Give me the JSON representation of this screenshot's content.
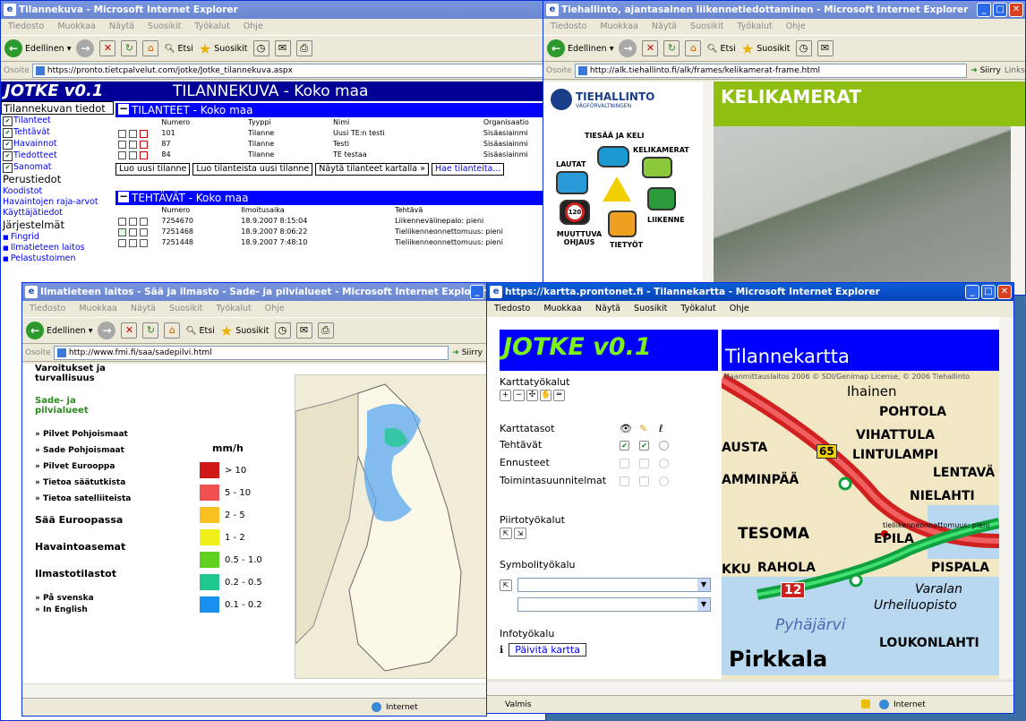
{
  "menu": [
    "Tiedosto",
    "Muokkaa",
    "Näytä",
    "Suosikit",
    "Työkalut",
    "Ohje"
  ],
  "toolbar": {
    "back": "Edellinen",
    "search": "Etsi",
    "favorites": "Suosikit"
  },
  "address_label": "Osoite",
  "go_label": "Siirry",
  "links_label": "Links",
  "status_internet": "Internet",
  "jotke": {
    "title": "Tilannekuva - Microsoft Internet Explorer",
    "url": "https://pronto.tietcpalvelut.com/jotke/Jotke_tilannekuva.aspx",
    "logo": "JOTKE v0.1",
    "page_title": "TILANNEKUVA - Koko maa",
    "side_header1": "Tilannekuvan tiedot",
    "side_checks": [
      "Tilanteet",
      "Tehtävät",
      "Havainnot",
      "Tiedotteet",
      "Sanomat"
    ],
    "side_header2": "Perustiedot",
    "side_links1": [
      "Koodistot",
      "Havaintojen raja-arvot",
      "Käyttäjätiedot"
    ],
    "side_header3": "Järjestelmät",
    "side_links2": [
      "Fingrid",
      "Ilmatieteen laitos",
      "Pelastustoimen"
    ],
    "tilanteet_header": "TILANTEET - Koko maa",
    "tilanteet_cols": [
      "Numero",
      "Tyyppi",
      "Nimi",
      "Organisaatio"
    ],
    "tilanteet_rows": [
      [
        "101",
        "Tilanne",
        "Uusi TE:n testi",
        "Sisäasiainmi"
      ],
      [
        "87",
        "Tilanne",
        "Testi",
        "Sisäasiainmi"
      ],
      [
        "84",
        "Tilanne",
        "TE testaa",
        "Sisäasiainmi"
      ]
    ],
    "buttons": [
      "Luo uusi tilanne",
      "Luo tilanteista uusi tilanne",
      "Näytä tilanteet kartalla »",
      "Hae tilanteita..."
    ],
    "tehtavat_header": "TEHTÄVÄT - Koko maa",
    "tehtavat_cols": [
      "Numero",
      "Ilmoitusaika",
      "Tehtävä"
    ],
    "tehtavat_rows": [
      [
        "7254670",
        "18.9.2007 8:15:04",
        "Liikennevälinepalo: pieni"
      ],
      [
        "7251468",
        "18.9.2007 8:06:22",
        "Tieliikenneonnettomuus: pieni"
      ],
      [
        "7251448",
        "18.9.2007 7:48:10",
        "Tieliikenneonnettomuus: pieni"
      ]
    ]
  },
  "tiehallinto": {
    "title": "Tiehallinto, ajantasainen liikennetiedottaminen - Microsoft Internet Explorer",
    "url": "http://alk.tiehallinto.fi/alk/frames/kelikamerat-frame.html",
    "org": "TIEHALLINTO",
    "org_sub": "VÄGFÖRVALTNINGEN",
    "banner": "KELIKAMERAT",
    "icons": [
      "TIESÄÄ JA KELI",
      "KELIKAMERAT",
      "LAUTAT",
      "LIIKENNE",
      "MUUTTUVA OHJAUS",
      "TIETYÖT"
    ],
    "speed": "120"
  },
  "fmi": {
    "title": "Ilmatieteen laitos - Sää ja ilmasto - Sade- ja pilvialueet - Microsoft Internet Explorer",
    "url": "http://www.fmi.fi/saa/sadepilvi.html",
    "cat1": "Varoitukset ja turvallisuus",
    "cat2": "Sade- ja pilvialueet",
    "items": [
      "» Pilvet Pohjoismaat",
      "» Sade Pohjoismaat",
      "» Pilvet Eurooppa",
      "» Tietoa säätutkista",
      "» Tietoa satelliiteista"
    ],
    "sections": [
      "Sää Euroopassa",
      "Havaintoasemat",
      "Ilmastotilastot"
    ],
    "langs": [
      "» På svenska",
      "» In English"
    ],
    "unit": "mm/h",
    "legend": [
      {
        "label": "> 10",
        "color": "#d01818"
      },
      {
        "label": "5 - 10",
        "color": "#f05050"
      },
      {
        "label": "2 - 5",
        "color": "#f8c020"
      },
      {
        "label": "1 - 2",
        "color": "#f0f018"
      },
      {
        "label": "0.5 - 1.0",
        "color": "#60d020"
      },
      {
        "label": "0.2 - 0.5",
        "color": "#20c890"
      },
      {
        "label": "0.1 - 0.2",
        "color": "#1890f0"
      }
    ]
  },
  "kartta": {
    "title": "https://kartta.prontonet.fi - Tilannekartta - Microsoft Internet Explorer",
    "logo": "JOTKE v0.1",
    "heading": "Tilannekartta",
    "tools1": "Karttatyökalut",
    "layers": "Karttatasot",
    "layer_rows": [
      "Tehtävät",
      "Ennusteet",
      "Toimintasuunnitelmat"
    ],
    "tools2": "Piirtotyökalut",
    "tools3": "Symbolityökalu",
    "tools4": "Infotyökalu",
    "refresh": "Päivitä kartta",
    "status": "Valmis",
    "copyright": "Maanmittauslaitos 2006 © SDI/Genimap License, © 2006 Tiehallinto",
    "places": [
      "Ihainen",
      "POHTOLA",
      "VIHATTULA",
      "LINTULAMPI",
      "AUSTA",
      "LENTAVÄ",
      "AMMINPÄÄ",
      "NIELAHTI",
      "TESOMA",
      "EPILA",
      "KKU",
      "RAHOLA",
      "PISPALA",
      "Varalan",
      "Urheiluopisto",
      "Pyhäjärvi",
      "LOUKONLAHTI",
      "Pirkkala"
    ],
    "roads": [
      "65",
      "12"
    ],
    "marker": "tieliikenneonnettomuus: pieni"
  }
}
